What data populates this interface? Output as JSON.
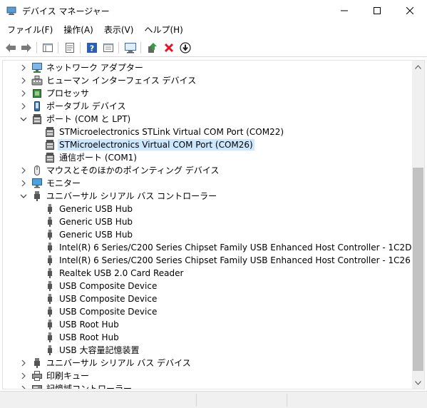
{
  "window": {
    "title": "デバイス マネージャー",
    "icon": "device-manager-icon"
  },
  "menu": {
    "items": [
      "ファイル(F)",
      "操作(A)",
      "表示(V)",
      "ヘルプ(H)"
    ]
  },
  "toolbar": {
    "buttons": [
      "back-icon",
      "forward-icon",
      "console-tree-icon",
      "properties-icon",
      "help-icon",
      "view-icon",
      "scan-hardware-icon",
      "update-driver-icon",
      "uninstall-icon",
      "disable-icon"
    ]
  },
  "tree": {
    "rows": [
      {
        "label": "ネットワーク アダプター",
        "icon": "network-adapter-icon",
        "level": 0,
        "expander": "collapsed"
      },
      {
        "label": "ヒューマン インターフェイス デバイス",
        "icon": "hid-icon",
        "level": 0,
        "expander": "collapsed"
      },
      {
        "label": "プロセッサ",
        "icon": "processor-icon",
        "level": 0,
        "expander": "collapsed"
      },
      {
        "label": "ポータブル デバイス",
        "icon": "portable-device-icon",
        "level": 0,
        "expander": "collapsed"
      },
      {
        "label": "ポート (COM と LPT)",
        "icon": "port-icon",
        "level": 0,
        "expander": "expanded"
      },
      {
        "label": "STMicroelectronics STLink Virtual COM Port (COM22)",
        "icon": "port-icon",
        "level": 1,
        "expander": "none"
      },
      {
        "label": "STMicroelectronics Virtual COM Port (COM26)",
        "icon": "port-icon",
        "level": 1,
        "expander": "none",
        "selected": true
      },
      {
        "label": "通信ポート (COM1)",
        "icon": "port-icon",
        "level": 1,
        "expander": "none"
      },
      {
        "label": "マウスとそのほかのポインティング デバイス",
        "icon": "mouse-icon",
        "level": 0,
        "expander": "collapsed"
      },
      {
        "label": "モニター",
        "icon": "monitor-icon",
        "level": 0,
        "expander": "collapsed"
      },
      {
        "label": "ユニバーサル シリアル バス コントローラー",
        "icon": "usb-controller-icon",
        "level": 0,
        "expander": "expanded"
      },
      {
        "label": "Generic USB Hub",
        "icon": "usb-icon",
        "level": 1,
        "expander": "none"
      },
      {
        "label": "Generic USB Hub",
        "icon": "usb-icon",
        "level": 1,
        "expander": "none"
      },
      {
        "label": "Generic USB Hub",
        "icon": "usb-icon",
        "level": 1,
        "expander": "none"
      },
      {
        "label": "Intel(R) 6 Series/C200 Series Chipset Family USB Enhanced Host Controller - 1C2D",
        "icon": "usb-icon",
        "level": 1,
        "expander": "none"
      },
      {
        "label": "Intel(R) 6 Series/C200 Series Chipset Family USB Enhanced Host Controller - 1C26",
        "icon": "usb-icon",
        "level": 1,
        "expander": "none"
      },
      {
        "label": "Realtek USB 2.0 Card Reader",
        "icon": "usb-icon",
        "level": 1,
        "expander": "none"
      },
      {
        "label": "USB Composite Device",
        "icon": "usb-icon",
        "level": 1,
        "expander": "none"
      },
      {
        "label": "USB Composite Device",
        "icon": "usb-icon",
        "level": 1,
        "expander": "none"
      },
      {
        "label": "USB Composite Device",
        "icon": "usb-icon",
        "level": 1,
        "expander": "none"
      },
      {
        "label": "USB Root Hub",
        "icon": "usb-icon",
        "level": 1,
        "expander": "none"
      },
      {
        "label": "USB Root Hub",
        "icon": "usb-icon",
        "level": 1,
        "expander": "none"
      },
      {
        "label": "USB 大容量記憶装置",
        "icon": "usb-icon",
        "level": 1,
        "expander": "none"
      },
      {
        "label": "ユニバーサル シリアル バス デバイス",
        "icon": "usb-controller-icon",
        "level": 0,
        "expander": "collapsed"
      },
      {
        "label": "印刷キュー",
        "icon": "print-queue-icon",
        "level": 0,
        "expander": "collapsed"
      },
      {
        "label": "記憶域コントローラー",
        "icon": "storage-controller-icon",
        "level": 0,
        "expander": "collapsed"
      }
    ]
  },
  "colors": {
    "selection": "#cce8ff",
    "accent_red": "#e81123",
    "accent_blue": "#1f5fbf",
    "accent_green": "#2f9e44"
  }
}
